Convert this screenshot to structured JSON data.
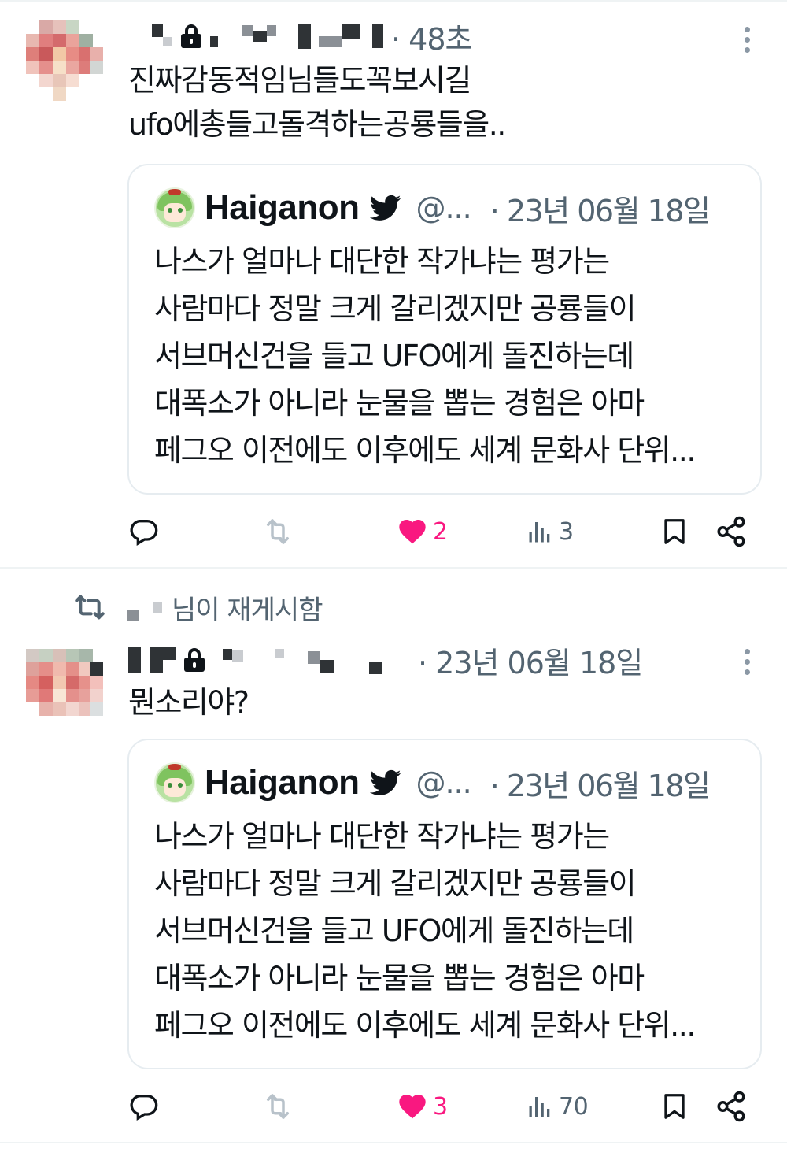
{
  "tweets": [
    {
      "time": "· 48초",
      "text_lines": [
        "진짜감동적임님들도꼭보시길",
        "ufo에총들고돌격하는공룡들을.."
      ],
      "quote": {
        "name": "Haiganon",
        "handle": "@...",
        "time": "· 23년 06월 18일",
        "lines": [
          "나스가 얼마나 대단한 작가냐는 평가는",
          "사람마다 정말 크게 갈리겠지만 공룡들이",
          "서브머신건을 들고 UFO에게 돌진하는데",
          "대폭소가 아니라 눈물을 뽑는 경험은 아마",
          "페그오 이전에도 이후에도 세계 문화사 단위..."
        ]
      },
      "likes": "2",
      "views": "3"
    },
    {
      "retweet_label": "님이 재게시함",
      "time": "· 23년 06월 18일",
      "text_lines": [
        "뭔소리야?"
      ],
      "quote": {
        "name": "Haiganon",
        "handle": "@...",
        "time": "· 23년 06월 18일",
        "lines": [
          "나스가 얼마나 대단한 작가냐는 평가는",
          "사람마다 정말 크게 갈리겠지만 공룡들이",
          "서브머신건을 들고 UFO에게 돌진하는데",
          "대폭소가 아니라 눈물을 뽑는 경험은 아마",
          "페그오 이전에도 이후에도 세계 문화사 단위..."
        ]
      },
      "likes": "3",
      "views": "70"
    }
  ],
  "colors": {
    "like": "#f91880",
    "muted": "#536471",
    "text": "#0f1419",
    "border": "#e6ecf0"
  },
  "icons": [
    "lock-icon",
    "more-icon",
    "twitter-bird-icon",
    "reply-icon",
    "retweet-icon",
    "heart-icon",
    "views-icon",
    "bookmark-icon",
    "share-icon"
  ]
}
